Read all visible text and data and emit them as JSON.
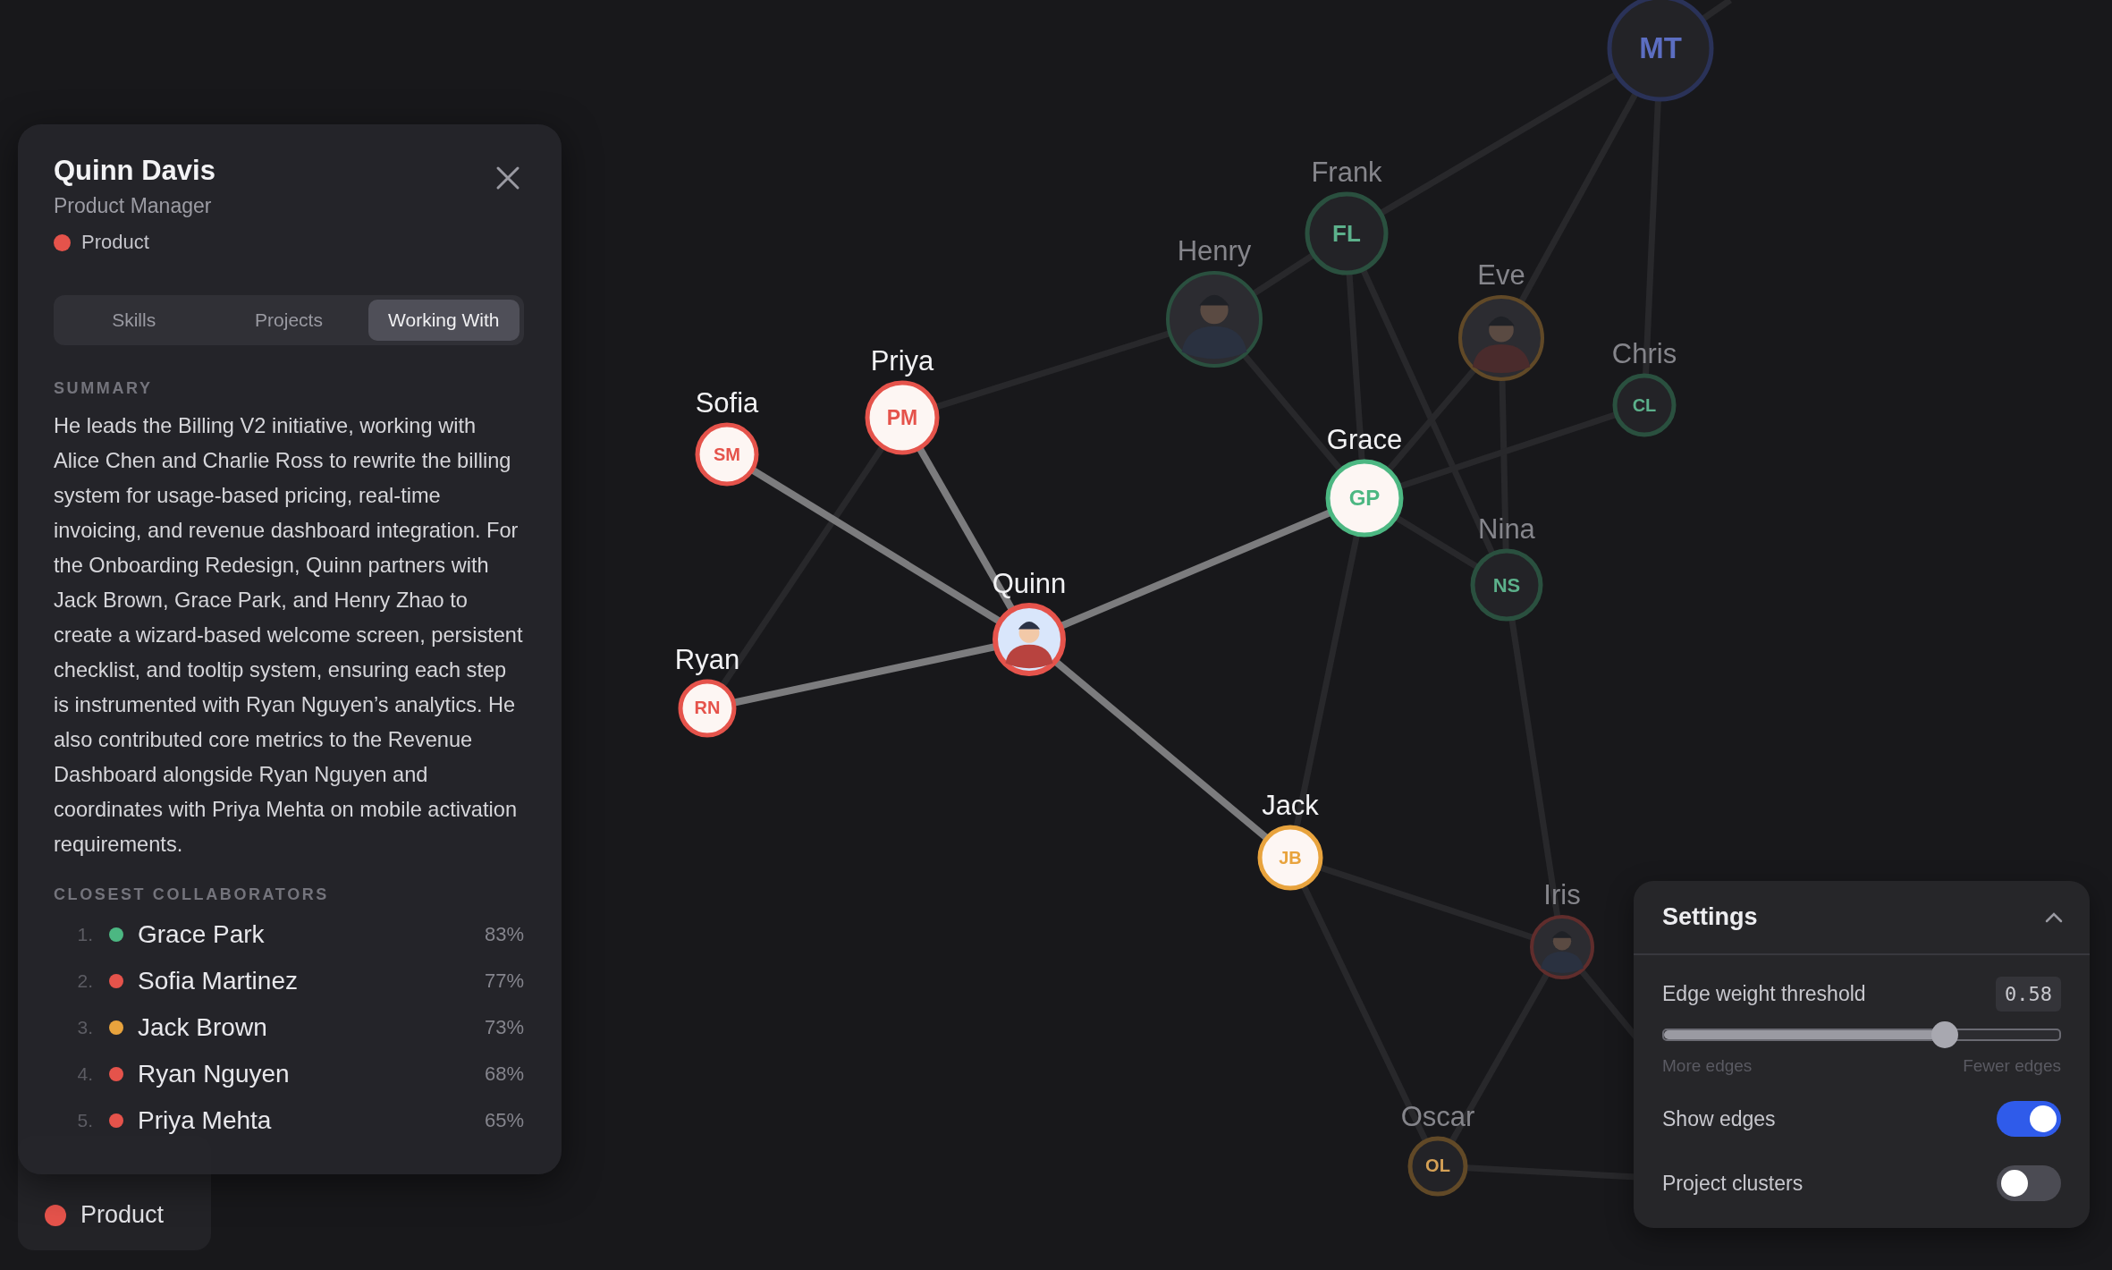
{
  "detail_panel": {
    "name": "Quinn Davis",
    "role": "Product Manager",
    "team": {
      "label": "Product",
      "color": "#e5534b"
    },
    "tabs": [
      {
        "label": "Skills",
        "selected": false
      },
      {
        "label": "Projects",
        "selected": false
      },
      {
        "label": "Working With",
        "selected": true
      }
    ],
    "summary_heading": "SUMMARY",
    "summary": "He leads the Billing V2 initiative, working with Alice Chen and Charlie Ross to rewrite the billing system for usage-based pricing, real-time invoicing, and revenue dashboard integration. For the Onboarding Redesign, Quinn partners with Jack Brown, Grace Park, and Henry Zhao to create a wizard-based welcome screen, persistent checklist, and tooltip system, ensuring each step is instrumented with Ryan Nguyen’s analytics. He also contributed core metrics to the Revenue Dashboard alongside Ryan Nguyen and coordinates with Priya Mehta on mobile activation requirements.",
    "collaborators_heading": "CLOSEST COLLABORATORS",
    "collaborators": [
      {
        "rank": "1.",
        "name": "Grace Park",
        "color": "#4cb782",
        "score": "83%"
      },
      {
        "rank": "2.",
        "name": "Sofia Martinez",
        "color": "#e5534b",
        "score": "77%"
      },
      {
        "rank": "3.",
        "name": "Jack Brown",
        "color": "#e8a33d",
        "score": "73%"
      },
      {
        "rank": "4.",
        "name": "Ryan Nguyen",
        "color": "#e5534b",
        "score": "68%"
      },
      {
        "rank": "5.",
        "name": "Priya Mehta",
        "color": "#e5534b",
        "score": "65%"
      }
    ]
  },
  "legend": [
    {
      "label": "Product",
      "color": "#e5534b"
    }
  ],
  "graph": {
    "nodes": [
      {
        "initials": "MT",
        "kind": "initials",
        "color": "#2a3258",
        "highlighted": false,
        "selected": false
      },
      {
        "label": "Frank",
        "initials": "FL",
        "kind": "initials",
        "color": "#2a503f",
        "highlighted": false,
        "selected": false
      },
      {
        "label": "Henry",
        "kind": "avatar",
        "color": "#2a503f",
        "highlighted": false,
        "selected": false
      },
      {
        "label": "Eve",
        "kind": "avatar",
        "color": "#614927",
        "highlighted": false,
        "selected": false
      },
      {
        "label": "Chris",
        "initials": "CL",
        "kind": "initials",
        "color": "#2a503f",
        "highlighted": false,
        "selected": false
      },
      {
        "label": "Grace",
        "initials": "GP",
        "kind": "initials",
        "color": "#4cb782",
        "highlighted": true,
        "selected": false
      },
      {
        "label": "Nina",
        "initials": "NS",
        "kind": "initials",
        "color": "#2a503f",
        "highlighted": false,
        "selected": false
      },
      {
        "label": "Priya",
        "initials": "PM",
        "kind": "initials",
        "color": "#e5534b",
        "highlighted": true,
        "selected": false
      },
      {
        "label": "Sofia",
        "initials": "SM",
        "kind": "initials",
        "color": "#e5534b",
        "highlighted": true,
        "selected": false
      },
      {
        "label": "Quinn",
        "kind": "avatar",
        "color": "#e5534b",
        "highlighted": true,
        "selected": true
      },
      {
        "label": "Ryan",
        "initials": "RN",
        "kind": "initials",
        "color": "#e5534b",
        "highlighted": true,
        "selected": false
      },
      {
        "label": "Jack",
        "initials": "JB",
        "kind": "initials",
        "color": "#e8a33d",
        "highlighted": true,
        "selected": false
      },
      {
        "label": "Iris",
        "kind": "avatar",
        "color": "#602d2c",
        "highlighted": false,
        "selected": false
      },
      {
        "label": "Oscar",
        "initials": "OL",
        "kind": "initials",
        "color": "#614927",
        "highlighted": false,
        "selected": false
      }
    ]
  },
  "settings": {
    "title": "Settings",
    "expanded": true,
    "threshold": {
      "label": "Edge weight threshold",
      "reading": "0.58",
      "level": 0.71,
      "min_label": "More edges",
      "max_label": "Fewer edges"
    },
    "toggles": [
      {
        "label": "Show edges",
        "on": true
      },
      {
        "label": "Project clusters",
        "on": false
      }
    ]
  }
}
